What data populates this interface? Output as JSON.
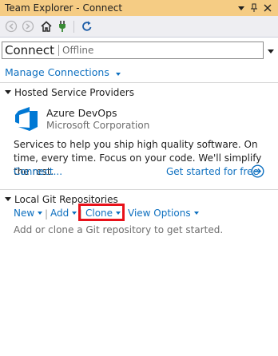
{
  "window": {
    "title": "Team Explorer - Connect"
  },
  "toolbar": {
    "buttons": [
      "back-icon",
      "forward-icon",
      "home-icon",
      "plug-icon",
      "refresh-icon"
    ]
  },
  "page": {
    "title": "Connect",
    "status": "Offline"
  },
  "links": {
    "manage_connections": "Manage Connections"
  },
  "hosted": {
    "header": "Hosted Service Providers",
    "provider": {
      "name": "Azure DevOps",
      "company": "Microsoft Corporation",
      "description": "Services to help you ship high quality software. On time, every time. Focus on your code. We'll simplify the rest.",
      "connect_label": "Connect...",
      "get_started_label": "Get started for free"
    }
  },
  "local_git": {
    "header": "Local Git Repositories",
    "actions": {
      "new": "New",
      "add": "Add",
      "clone": "Clone",
      "view_options": "View Options"
    },
    "separator": "|",
    "hint": "Add or clone a Git repository to get started."
  },
  "colors": {
    "title_bar": "#f5cc84",
    "link": "#0e70c0",
    "highlight": "#e8111a",
    "azure_blue": "#0078d4"
  }
}
